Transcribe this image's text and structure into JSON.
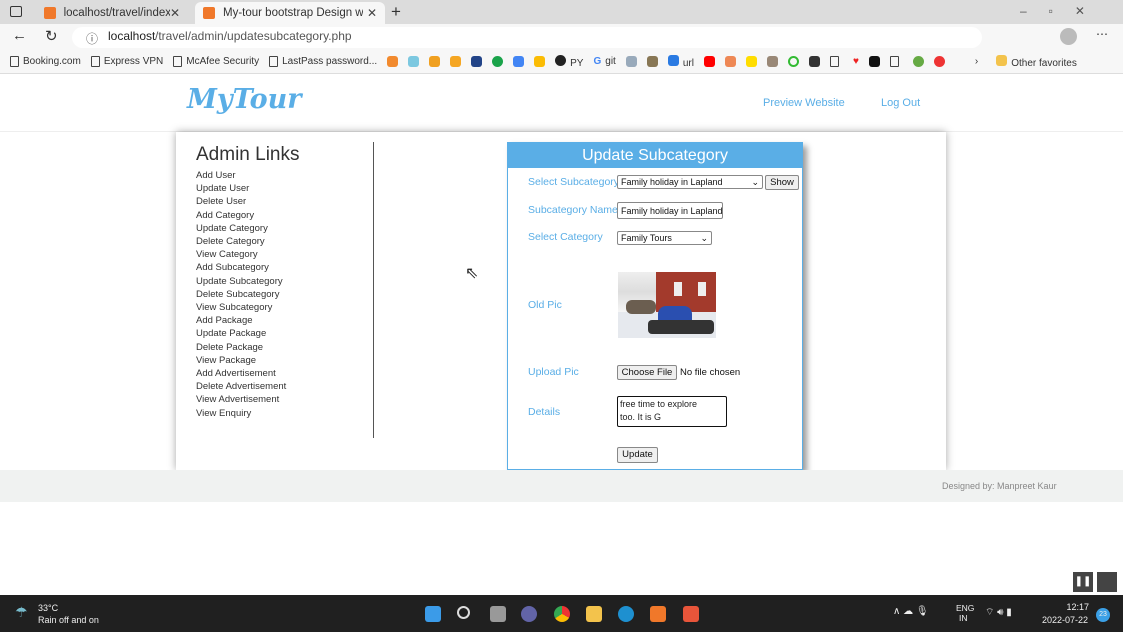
{
  "browser": {
    "tabs": [
      {
        "title": "localhost/travel/index.php#sectio"
      },
      {
        "title": "My-tour bootstrap Design websi"
      }
    ],
    "url_host": "localhost",
    "url_path": "/travel/admin/updatesubcategory.php",
    "bookmarks": [
      "Booking.com",
      "Express VPN",
      "McAfee Security",
      "LastPass password...",
      "PY",
      "git",
      "url"
    ],
    "other_favorites": "Other favorites"
  },
  "site": {
    "logo": "MyTour",
    "nav": [
      "Preview Website",
      "Log Out"
    ]
  },
  "admin": {
    "title": "Admin Links",
    "links": [
      "Add User",
      "Update User",
      "Delete User",
      "Add Category",
      "Update Category",
      "Delete Category",
      "View Category",
      "Add Subcategory",
      "Update Subcategory",
      "Delete Subcategory",
      "View Subcategory",
      "Add Package",
      "Update Package",
      "Delete Package",
      "View Package",
      "Add Advertisement",
      "Delete Advertisement",
      "View Advertisement",
      "View Enquiry"
    ]
  },
  "form": {
    "title": "Update Subcategory",
    "select_subcategory_label": "Select Subcategory",
    "select_subcategory_value": "Family holiday in Lapland",
    "show_button": "Show",
    "name_label": "Subcategory Name",
    "name_value": "Family holiday in Lapland",
    "category_label": "Select Category",
    "category_value": "Family Tours",
    "old_pic_label": "Old Pic",
    "upload_label": "Upload Pic",
    "choose_file": "Choose File",
    "no_file": "No file chosen",
    "details_label": "Details",
    "details_value": "free time to explore too. It is G",
    "update_button": "Update"
  },
  "footer": {
    "credit": "Designed by: Manpreet Kaur"
  },
  "taskbar": {
    "temp": "33°C",
    "weather": "Rain off and on",
    "lang1": "ENG",
    "lang2": "IN",
    "time": "12:17",
    "date": "2022-07-22",
    "badge": "23"
  }
}
